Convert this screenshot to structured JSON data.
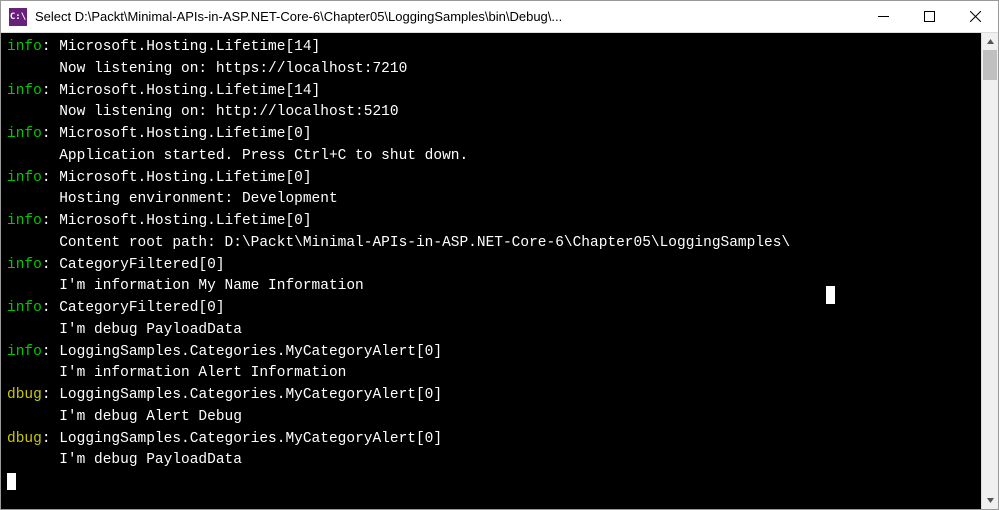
{
  "window": {
    "icon_text": "C:\\",
    "title": "Select D:\\Packt\\Minimal-APIs-in-ASP.NET-Core-6\\Chapter05\\LoggingSamples\\bin\\Debug\\..."
  },
  "log_entries": [
    {
      "level": "info",
      "category": "Microsoft.Hosting.Lifetime[14]",
      "message": "Now listening on: https://localhost:7210"
    },
    {
      "level": "info",
      "category": "Microsoft.Hosting.Lifetime[14]",
      "message": "Now listening on: http://localhost:5210"
    },
    {
      "level": "info",
      "category": "Microsoft.Hosting.Lifetime[0]",
      "message": "Application started. Press Ctrl+C to shut down."
    },
    {
      "level": "info",
      "category": "Microsoft.Hosting.Lifetime[0]",
      "message": "Hosting environment: Development"
    },
    {
      "level": "info",
      "category": "Microsoft.Hosting.Lifetime[0]",
      "message": "Content root path: D:\\Packt\\Minimal-APIs-in-ASP.NET-Core-6\\Chapter05\\LoggingSamples\\"
    },
    {
      "level": "info",
      "category": "CategoryFiltered[0]",
      "message": "I'm information My Name Information"
    },
    {
      "level": "info",
      "category": "CategoryFiltered[0]",
      "message": "I'm debug PayloadData"
    },
    {
      "level": "info",
      "category": "LoggingSamples.Categories.MyCategoryAlert[0]",
      "message": "I'm information Alert Information"
    },
    {
      "level": "dbug",
      "category": "LoggingSamples.Categories.MyCategoryAlert[0]",
      "message": "I'm debug Alert Debug"
    },
    {
      "level": "dbug",
      "category": "LoggingSamples.Categories.MyCategoryAlert[0]",
      "message": "I'm debug PayloadData"
    }
  ],
  "indent": "      "
}
